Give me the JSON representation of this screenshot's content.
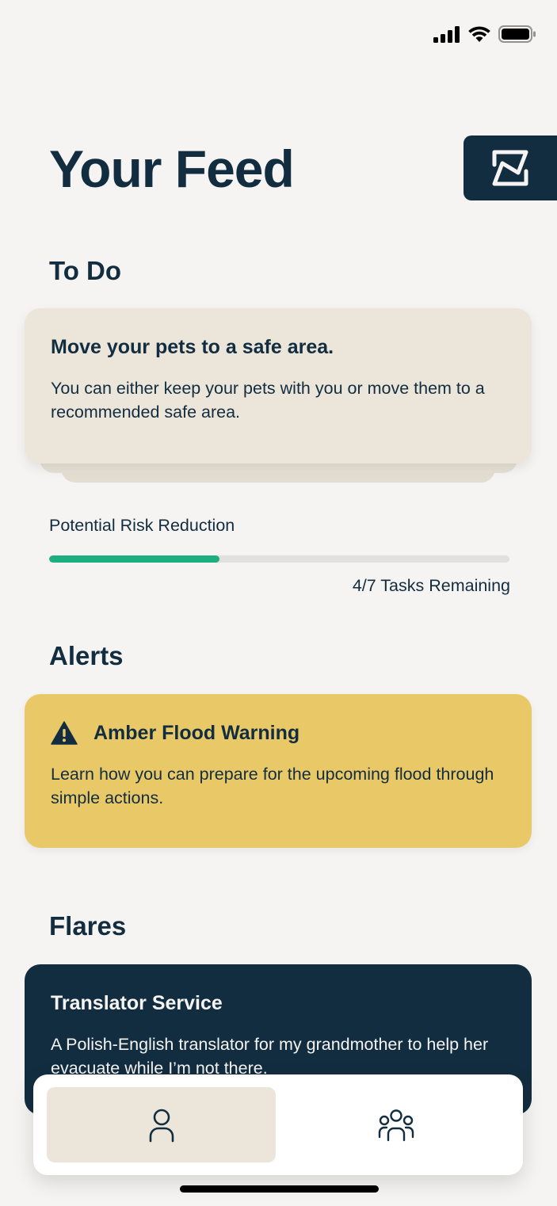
{
  "page_title": "Your Feed",
  "todo": {
    "heading": "To Do",
    "card": {
      "title": "Move your pets to a safe area.",
      "body": "You can either keep your pets with you or move them to a recommended safe area."
    },
    "progress_label": "Potential Risk Reduction",
    "progress_fraction": 0.37,
    "tasks_remaining": "4/7 Tasks Remaining"
  },
  "alerts": {
    "heading": "Alerts",
    "card": {
      "title": "Amber Flood Warning",
      "body": "Learn how you can prepare for the upcoming flood through simple actions."
    }
  },
  "flares": {
    "heading": "Flares",
    "card": {
      "title": "Translator Service",
      "body": "A Polish-English translator for my grandmother to help her evacuate while I’m not there."
    }
  },
  "tabs": [
    {
      "icon": "person-icon",
      "selected": true
    },
    {
      "icon": "group-icon",
      "selected": false
    }
  ],
  "colors": {
    "background": "#f5f4f2",
    "navy": "#132d40",
    "beige_card": "#ebe5da",
    "amber": "#e9c967",
    "progress_green": "#1fae80"
  }
}
